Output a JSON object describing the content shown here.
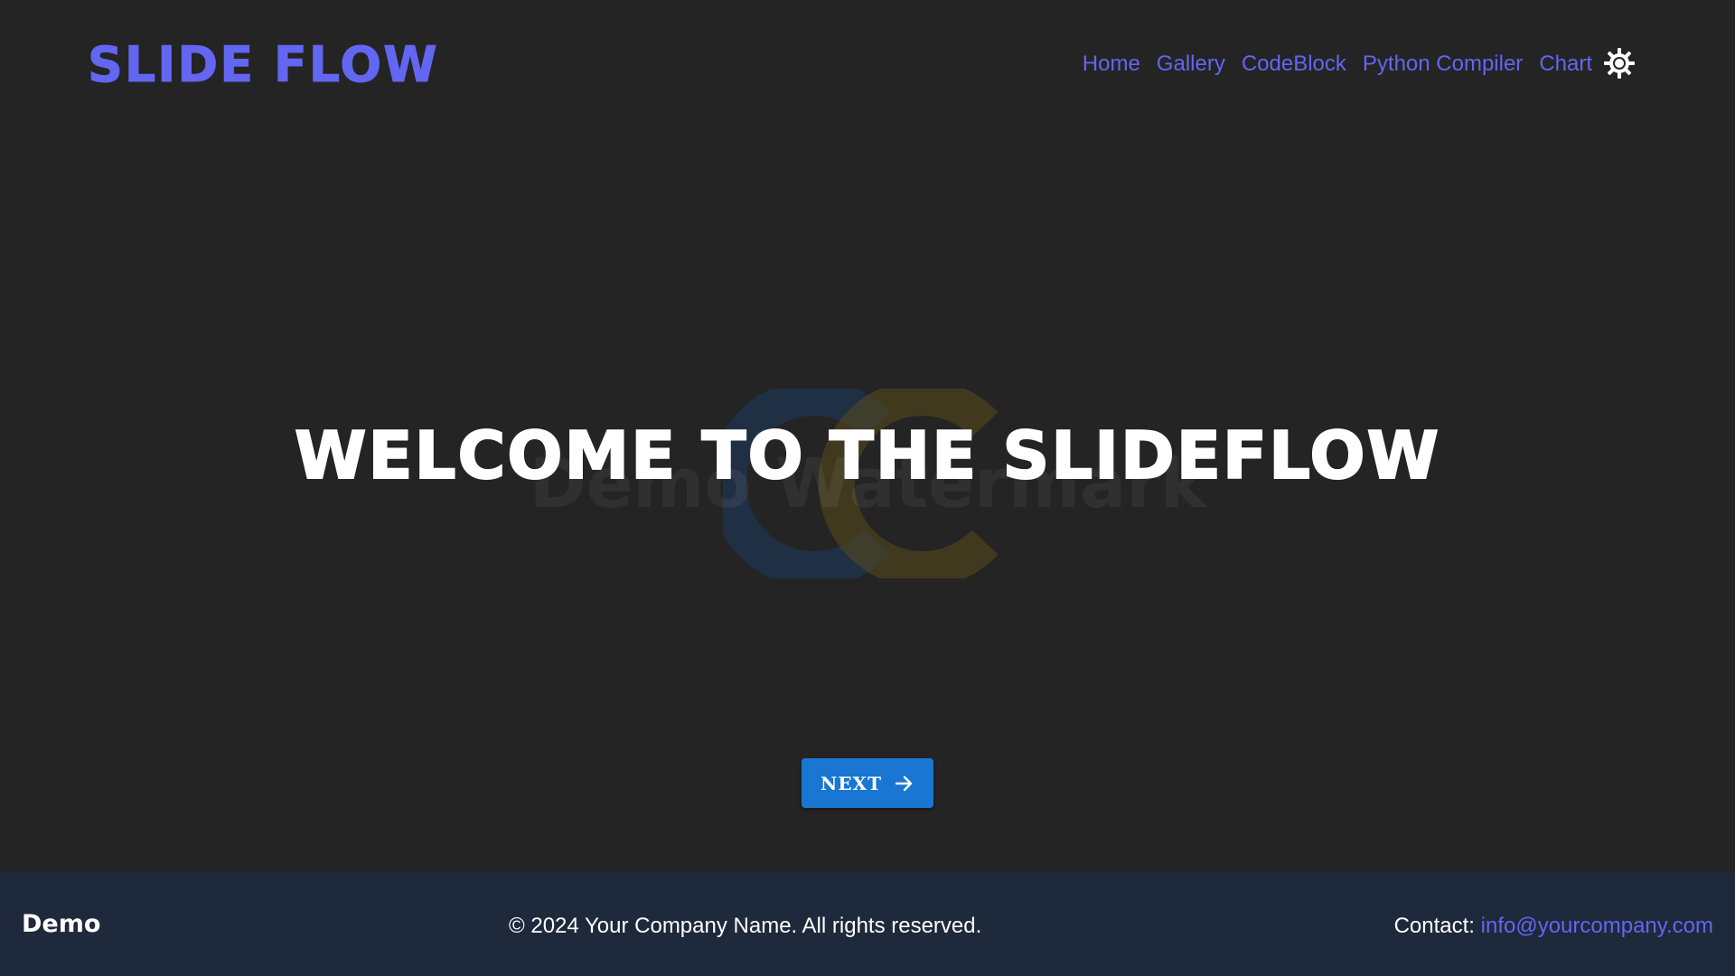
{
  "header": {
    "logo": "Slide Flow",
    "nav": [
      {
        "label": "Home"
      },
      {
        "label": "Gallery"
      },
      {
        "label": "CodeBlock"
      },
      {
        "label": "Python Compiler"
      },
      {
        "label": "Chart"
      }
    ],
    "theme_icon": "sun-icon"
  },
  "hero": {
    "title": "Welcome to the Slideflow",
    "watermark_text": "Demo Watermark",
    "next_button": {
      "label": "NEXT",
      "icon": "arrow-right-icon"
    }
  },
  "footer": {
    "brand": "Demo",
    "copyright": "© 2024 Your Company Name. All rights reserved.",
    "contact_label": "Contact: ",
    "contact_email": "info@yourcompany.com"
  },
  "colors": {
    "background": "#242424",
    "accent": "#6366f1",
    "button": "#1976d2",
    "footer": "#1e293b"
  }
}
